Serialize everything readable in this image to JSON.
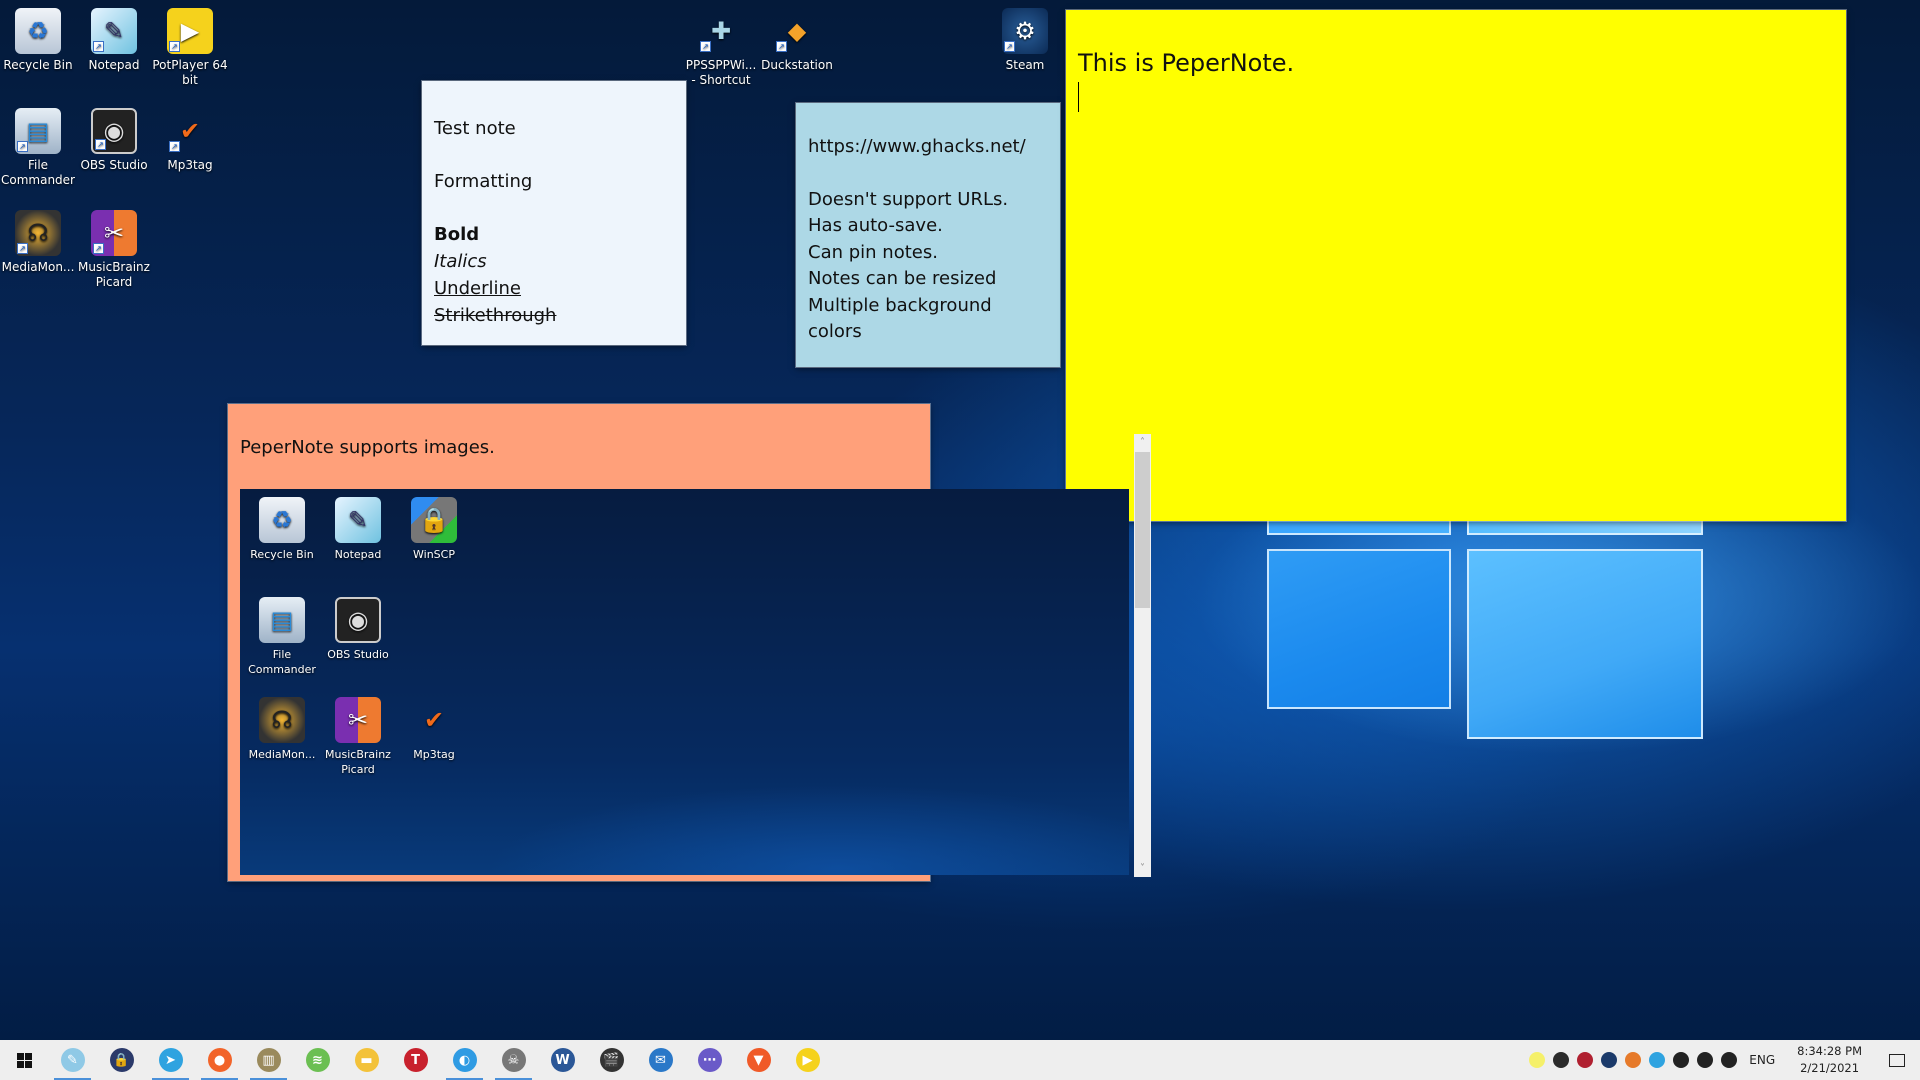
{
  "desktop": {
    "icons": [
      {
        "label": "Recycle Bin",
        "icon": "recycle-bin-icon",
        "glyph": "♻"
      },
      {
        "label": "Notepad",
        "icon": "notepad-icon",
        "glyph": "✎"
      },
      {
        "label": "PotPlayer 64 bit",
        "icon": "potplayer-icon",
        "glyph": "▶"
      },
      {
        "label": "File Commander",
        "icon": "file-commander-icon",
        "glyph": "▤"
      },
      {
        "label": "OBS Studio",
        "icon": "obs-studio-icon",
        "glyph": "◉"
      },
      {
        "label": "Mp3tag",
        "icon": "mp3tag-icon",
        "glyph": "✔"
      },
      {
        "label": "MediaMon...",
        "icon": "mediamonkey-icon",
        "glyph": "☊"
      },
      {
        "label": "MusicBrainz Picard",
        "icon": "musicbrainz-picard-icon",
        "glyph": "✂"
      },
      {
        "label": "PPSSPPWi... - Shortcut",
        "icon": "ppsspp-icon",
        "glyph": "✚"
      },
      {
        "label": "Duckstation",
        "icon": "duckstation-icon",
        "glyph": "◆"
      },
      {
        "label": "Steam",
        "icon": "steam-icon",
        "glyph": "⚙"
      }
    ]
  },
  "notes": {
    "white": {
      "lines": [
        "Test note",
        "Formatting",
        "Bold",
        "Italics",
        "Underline",
        "Strikethrough"
      ],
      "background": "#eef5fc"
    },
    "blue": {
      "url": "https://www.ghacks.net/",
      "lines": [
        "Doesn't support URLs.",
        "Has auto-save.",
        "Can pin notes.",
        "Notes can be resized",
        "Multiple background colors"
      ],
      "background": "#add8e6"
    },
    "yellow": {
      "text": "This is PeperNote.",
      "background": "#ffff00"
    },
    "salmon": {
      "text": "PeperNote supports images.",
      "background": "#ffa07a",
      "image_icons": [
        {
          "label": "Recycle Bin",
          "glyph": "♻"
        },
        {
          "label": "Notepad",
          "glyph": "✎"
        },
        {
          "label": "WinSCP",
          "glyph": "🔒"
        },
        {
          "label": "File Commander",
          "glyph": "▤"
        },
        {
          "label": "OBS Studio",
          "glyph": "◉"
        },
        {
          "label": "MediaMon...",
          "glyph": "☊"
        },
        {
          "label": "MusicBrainz Picard",
          "glyph": "✂"
        },
        {
          "label": "Mp3tag",
          "glyph": "✔"
        }
      ],
      "scroll_up": "˄",
      "scroll_down": "˅"
    }
  },
  "taskbar": {
    "apps": [
      {
        "name": "notepad",
        "glyph": "✎",
        "color": "#8fc9e6",
        "active": true
      },
      {
        "name": "keepass",
        "glyph": "🔒",
        "color": "#2b3a6a",
        "active": false
      },
      {
        "name": "telegram",
        "glyph": "➤",
        "color": "#2fa3e0",
        "active": true
      },
      {
        "name": "firefox",
        "glyph": "●",
        "color": "#f2642a",
        "active": true
      },
      {
        "name": "archive",
        "glyph": "▥",
        "color": "#9a8a5c",
        "active": true
      },
      {
        "name": "rss-reader",
        "glyph": "≋",
        "color": "#6bbf52",
        "active": false
      },
      {
        "name": "file-explorer",
        "glyph": "▬",
        "color": "#f3c23a",
        "active": false
      },
      {
        "name": "t-app",
        "glyph": "T",
        "color": "#c8212d",
        "active": false
      },
      {
        "name": "edge",
        "glyph": "◐",
        "color": "#2f9be3",
        "active": true
      },
      {
        "name": "alien-app",
        "glyph": "☠",
        "color": "#777777",
        "active": true
      },
      {
        "name": "word",
        "glyph": "W",
        "color": "#2b5797",
        "active": false
      },
      {
        "name": "video-editor",
        "glyph": "🎬",
        "color": "#333333",
        "active": false
      },
      {
        "name": "thunderbird",
        "glyph": "✉",
        "color": "#2a78c8",
        "active": false
      },
      {
        "name": "purple-app",
        "glyph": "⋯",
        "color": "#6a5ac8",
        "active": false
      },
      {
        "name": "brave",
        "glyph": "▼",
        "color": "#f05a28",
        "active": false
      },
      {
        "name": "potplayer",
        "glyph": "▶",
        "color": "#f5d21c",
        "active": false
      }
    ],
    "tray": {
      "icons": [
        {
          "name": "pepernote-tray-icon",
          "color": "#f5f06a"
        },
        {
          "name": "security-tray-icon",
          "color": "#2b2b2b"
        },
        {
          "name": "red-app-tray-icon",
          "color": "#b02030"
        },
        {
          "name": "steam-tray-icon",
          "color": "#1b3a6a"
        },
        {
          "name": "edge-tray-icon",
          "color": "#e67a2a"
        },
        {
          "name": "telegram-tray-icon",
          "color": "#2fa3e0"
        },
        {
          "name": "battery-tray-icon",
          "color": "#222222"
        },
        {
          "name": "wifi-tray-icon",
          "color": "#222222"
        },
        {
          "name": "volume-tray-icon",
          "color": "#222222"
        }
      ],
      "language": "ENG",
      "time": "8:34:28 PM",
      "date": "2/21/2021"
    }
  }
}
